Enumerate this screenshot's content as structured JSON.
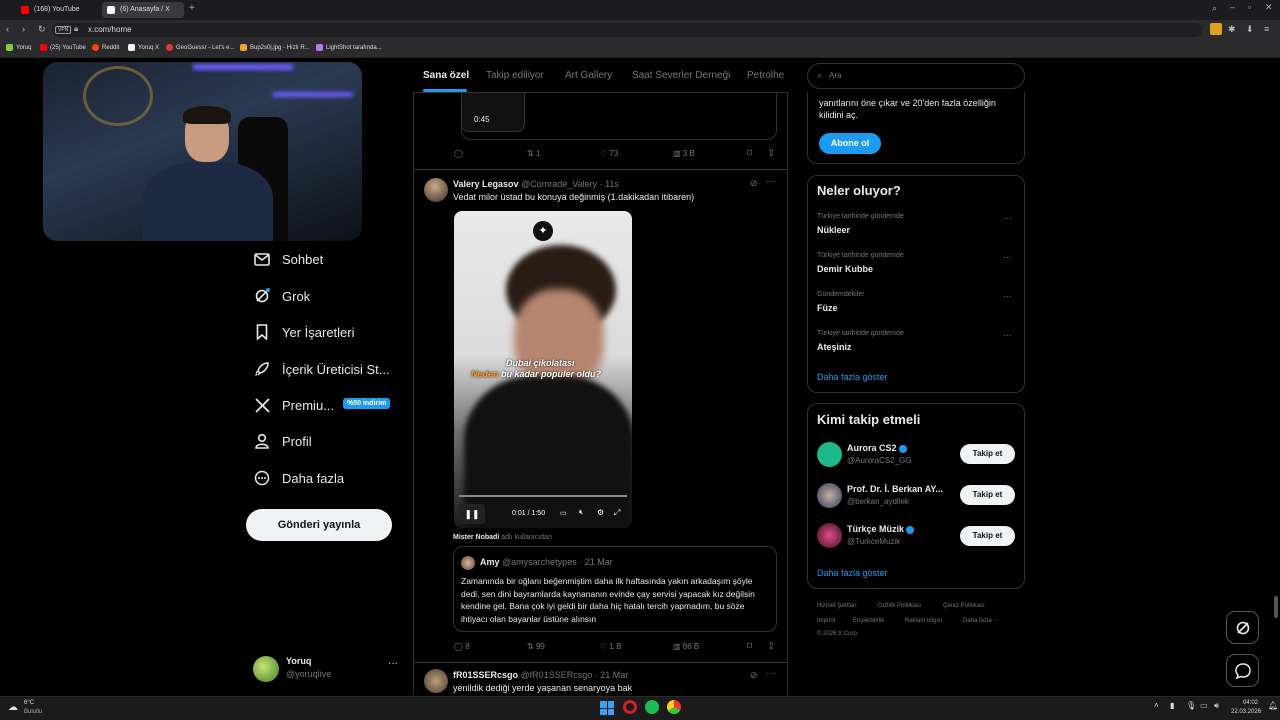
{
  "browser": {
    "tabs": [
      {
        "label": "(168) YouTube",
        "fav_color": "#ff0000"
      },
      {
        "label": "(6) Anasayfa / X",
        "fav_color": "#ffffff"
      }
    ],
    "url": "x.com/home",
    "vpn_label": "VPN",
    "bookmarks": [
      "Yoruq",
      "(25) YouTube",
      "Reddit",
      "Yoruq X",
      "GeoGuessr - Let's e...",
      "Bup2s0j.jpg - Hızlı R...",
      "LightShot tarafında..."
    ]
  },
  "sidebar": {
    "items": [
      {
        "label": "Sohbet",
        "icon": "mail-icon"
      },
      {
        "label": "Grok",
        "icon": "grok-icon"
      },
      {
        "label": "Yer İşaretleri",
        "icon": "bookmark-icon"
      },
      {
        "label": "İçerik Üreticisi St...",
        "icon": "rocket-icon"
      },
      {
        "label": "Premiu...",
        "icon": "x-logo-icon"
      },
      {
        "label": "Profil",
        "icon": "person-icon"
      },
      {
        "label": "Daha fazla",
        "icon": "more-circle-icon"
      }
    ],
    "premium_badge": "%50 indirim",
    "post_button": "Gönderi yayınla",
    "account": {
      "name": "Yoruq",
      "handle": "@yoruqlive"
    }
  },
  "feed": {
    "tabs": [
      "Sana özel",
      "Takip ediliyor",
      "Art Gallery",
      "Saat Severler Derneği",
      "Petrolhe"
    ],
    "prev_post": {
      "video_time": "0:45",
      "replies": "",
      "reposts": "1",
      "likes": "73",
      "views": "3 B"
    },
    "post1": {
      "name": "Valery Legasov",
      "handle": "@Comrade_Valery",
      "time": "· 11s",
      "text": "Vedat milor üstad bu konuya değinmiş (1.dakikadan itibaren)",
      "video_caption_line1": "Dubai çikolatası",
      "video_caption_line2a": "Neden",
      "video_caption_line2b": "bu kadar popüler oldu?",
      "video_time": "0:01 / 1:50",
      "quote_meta_name": "Mister Nobadi",
      "quote_meta_suffix": "adlı kullanıcıdan",
      "quote": {
        "name": "Amy",
        "handle": "@amysarchetypes",
        "time": "· 21 Mar",
        "text": "Zamanında bir oğlanı beğenmiştim daha ilk haftasında yakın arkadaşım şöyle dedi, sen dini bayramlarda kaynananın evinde çay servisi yapacak kız değilsin kendine gel. Bana çok iyi geldi bir daha hiç hatalı tercih yapmadım, bu söze ihtiyacı olan bayanlar üstüne alınsın"
      },
      "replies": "8",
      "reposts": "99",
      "likes": "1 B",
      "views": "86 B"
    },
    "post2": {
      "name": "fR01SSERcsgo",
      "handle": "@fR01SSERcsgo",
      "time": "· 21 Mar",
      "text": "yenildik dediği yerde yaşanan senaryoya bak"
    }
  },
  "right": {
    "search_placeholder": "Ara",
    "premium_text_line1": "yanıtlarını öne çıkar ve 20'den fazla özelliğin",
    "premium_text_line2": "kilidini aç.",
    "premium_button": "Abone ol",
    "trends_title": "Neler oluyor?",
    "trends": [
      {
        "category": "Türkiye tarihinde gündemde",
        "name": "Nükleer"
      },
      {
        "category": "Türkiye tarihinde gündemde",
        "name": "Demir Kubbe"
      },
      {
        "category": "Gündemdekiler",
        "name": "Füze"
      },
      {
        "category": "Türkiye tarihinde gündemde",
        "name": "Ateşiniz"
      }
    ],
    "show_more": "Daha fazla göster",
    "wtf_title": "Kimi takip etmeli",
    "wtf": [
      {
        "name": "Aurora CS2",
        "handle": "@AuroraCS2_GG",
        "button": "Takip et",
        "avatar_color": "#1fb88a"
      },
      {
        "name": "Prof. Dr. İ. Berkan AY...",
        "handle": "@berkan_aydilek",
        "button": "Takip et",
        "avatar_color": "#5a6b8c"
      },
      {
        "name": "Türkçe Müzik",
        "handle": "@TurkceMuzik",
        "button": "Takip et",
        "avatar_color": "#b0306a"
      }
    ],
    "wtf_show_more": "Daha fazla göster",
    "footer": [
      "Hizmet Şartları",
      "Gizlilik Politikası",
      "Çerez Politikası",
      "Imprint",
      "Erişilebilirlik",
      "Reklam bilgisi",
      "Daha fazla ···",
      "© 2026 X Corp."
    ]
  },
  "taskbar": {
    "weather_temp": "6°C",
    "weather_desc": "Bulutlu",
    "time": "04:02",
    "date": "22.03.2026"
  },
  "colors": {
    "accent": "#1d9bf0",
    "background": "#000000",
    "border": "#2f3336",
    "muted": "#71767b"
  }
}
